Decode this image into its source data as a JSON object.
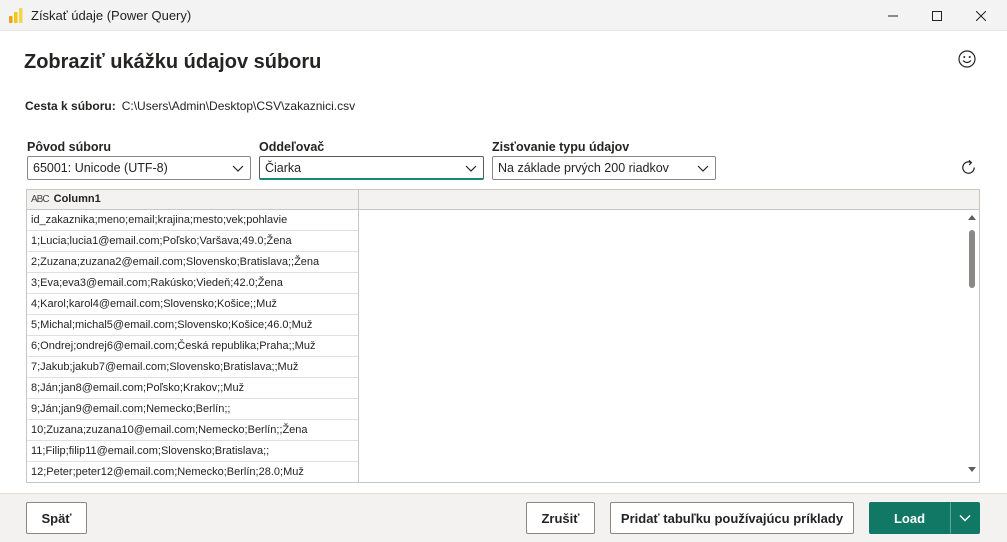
{
  "window": {
    "title": "Získať údaje (Power Query)"
  },
  "page": {
    "heading": "Zobraziť ukážku údajov súboru"
  },
  "file_path": {
    "label": "Cesta k súboru:",
    "value": "C:\\Users\\Admin\\Desktop\\CSV\\zakaznici.csv"
  },
  "options": {
    "origin": {
      "label": "Pôvod súboru",
      "value": "65001: Unicode (UTF-8)"
    },
    "delimiter": {
      "label": "Oddeľovač",
      "value": "Čiarka"
    },
    "type_detection": {
      "label": "Zisťovanie typu údajov",
      "value": "Na základe prvých 200 riadkov"
    }
  },
  "grid": {
    "type_icon": "ABC",
    "column_header": "Column1",
    "rows": [
      "id_zakaznika;meno;email;krajina;mesto;vek;pohlavie",
      "1;Lucia;lucia1@email.com;Poľsko;Varšava;49.0;Žena",
      "2;Zuzana;zuzana2@email.com;Slovensko;Bratislava;;Žena",
      "3;Eva;eva3@email.com;Rakúsko;Viedeň;42.0;Žena",
      "4;Karol;karol4@email.com;Slovensko;Košice;;Muž",
      "5;Michal;michal5@email.com;Slovensko;Košice;46.0;Muž",
      "6;Ondrej;ondrej6@email.com;Česká republika;Praha;;Muž",
      "7;Jakub;jakub7@email.com;Slovensko;Bratislava;;Muž",
      "8;Ján;jan8@email.com;Poľsko;Krakov;;Muž",
      "9;Ján;jan9@email.com;Nemecko;Berlín;;",
      "10;Zuzana;zuzana10@email.com;Nemecko;Berlín;;Žena",
      "11;Filip;filip11@email.com;Slovensko;Bratislava;;",
      "12;Peter;peter12@email.com;Nemecko;Berlín;28.0;Muž"
    ]
  },
  "footer": {
    "back_label": "Späť",
    "cancel_label": "Zrušiť",
    "example_label": "Pridať tabuľku používajúcu príklady",
    "load_label": "Load"
  },
  "colors": {
    "accent": "#117865",
    "focus_underline": "#118a79",
    "logo_yellow": "#f2c811"
  }
}
